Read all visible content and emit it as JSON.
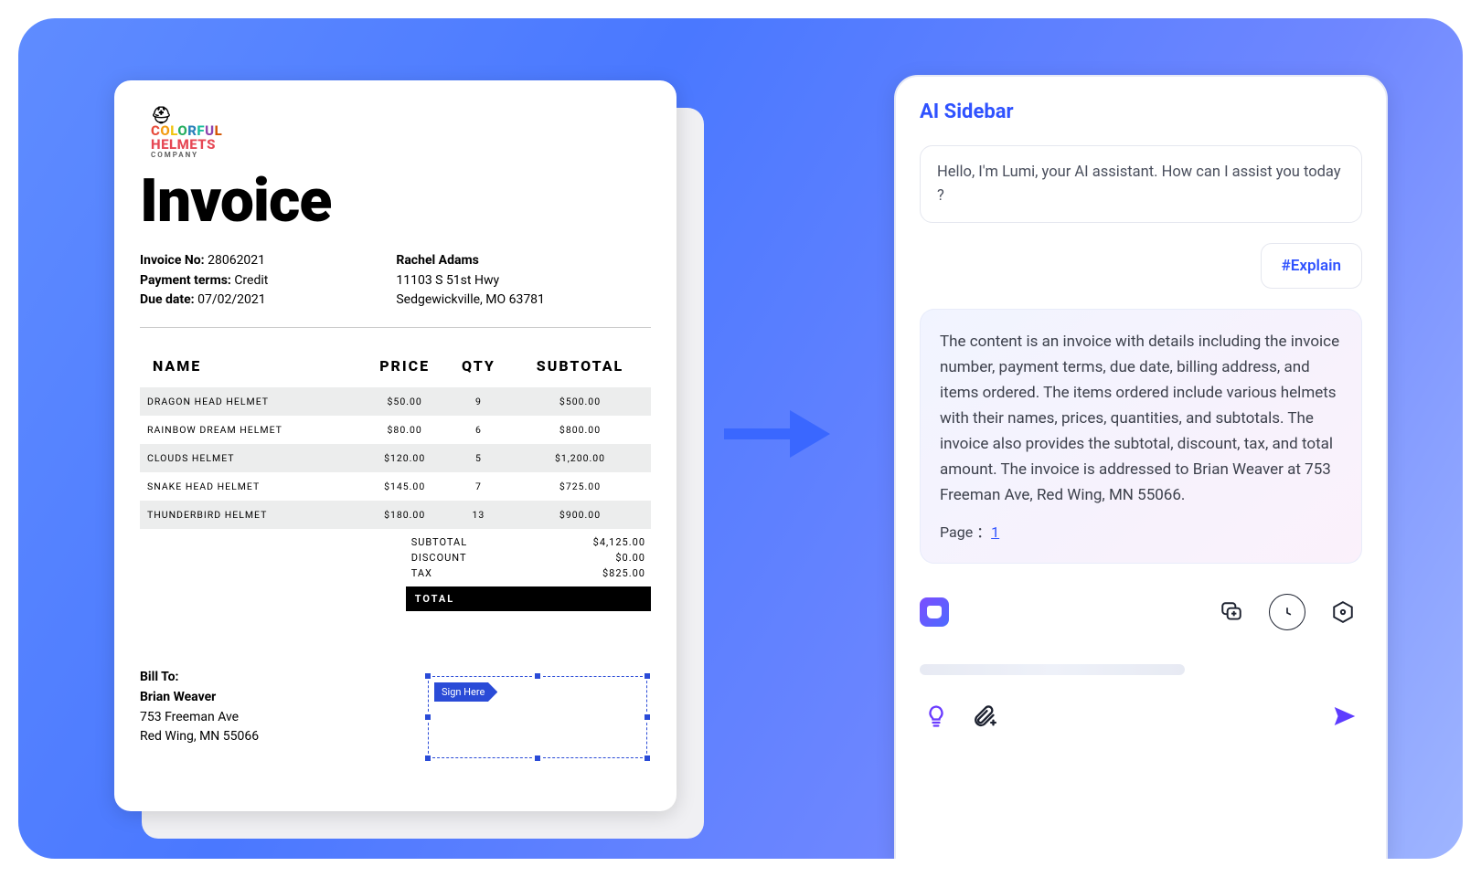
{
  "invoice": {
    "company": {
      "line1": "COLORFUL",
      "line2": "HELMETS",
      "line3": "COMPANY"
    },
    "title": "Invoice",
    "labels": {
      "invoiceNo": "Invoice No:",
      "paymentTerms": "Payment terms:",
      "dueDate": "Due date:"
    },
    "number": "28062021",
    "terms": "Credit",
    "dueDate": "07/02/2021",
    "billFrom": {
      "name": "Rachel Adams",
      "line1": "11103 S 51st Hwy",
      "line2": "Sedgewickville, MO 63781"
    },
    "columns": {
      "name": "NAME",
      "price": "PRICE",
      "qty": "QTY",
      "subtotal": "SUBTOTAL"
    },
    "items": [
      {
        "name": "DRAGON HEAD HELMET",
        "price": "$50.00",
        "qty": "9",
        "subtotal": "$500.00"
      },
      {
        "name": "RAINBOW DREAM HELMET",
        "price": "$80.00",
        "qty": "6",
        "subtotal": "$800.00"
      },
      {
        "name": "CLOUDS HELMET",
        "price": "$120.00",
        "qty": "5",
        "subtotal": "$1,200.00"
      },
      {
        "name": "SNAKE HEAD HELMET",
        "price": "$145.00",
        "qty": "7",
        "subtotal": "$725.00"
      },
      {
        "name": "THUNDERBIRD HELMET",
        "price": "$180.00",
        "qty": "13",
        "subtotal": "$900.00"
      }
    ],
    "totals": {
      "subtotalLabel": "SUBTOTAL",
      "subtotal": "$4,125.00",
      "discountLabel": "DISCOUNT",
      "discount": "$0.00",
      "taxLabel": "TAX",
      "tax": "$825.00",
      "totalLabel": "TOTAL"
    },
    "billTo": {
      "label": "Bill To:",
      "name": "Brian Weaver",
      "line1": "753 Freeman Ave",
      "line2": "Red Wing, MN 55066"
    },
    "signHere": "Sign Here"
  },
  "sidebar": {
    "title": "AI Sidebar",
    "greeting": "Hello, I'm Lumi, your AI assistant. How can I assist you today ?",
    "tag": "#Explain",
    "response": "The content is an invoice with details including the invoice number, payment terms, due date, billing address, and items ordered. The items ordered include various helmets with their names, prices, quantities, and subtotals. The invoice also provides the subtotal, discount, tax, and total amount. The invoice is addressed to Brian Weaver at 753 Freeman Ave, Red Wing, MN 55066.",
    "pageLabel": "Page ：",
    "pageLink": "1"
  }
}
